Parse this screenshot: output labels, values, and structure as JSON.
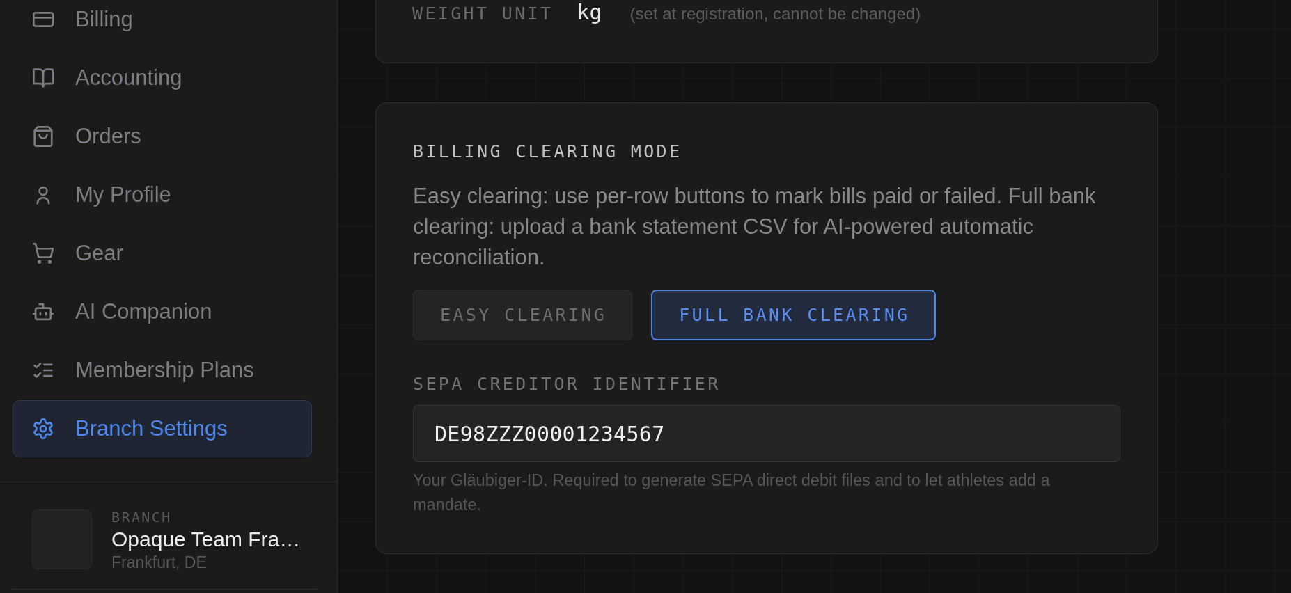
{
  "sidebar": {
    "nav_items": [
      {
        "label": "Billing",
        "selected": false
      },
      {
        "label": "Accounting",
        "selected": false
      },
      {
        "label": "Orders",
        "selected": false
      },
      {
        "label": "My Profile",
        "selected": false
      },
      {
        "label": "Gear",
        "selected": false
      },
      {
        "label": "AI Companion",
        "selected": false
      },
      {
        "label": "Membership Plans",
        "selected": false
      },
      {
        "label": "Branch Settings",
        "selected": true
      }
    ],
    "branch": {
      "label": "BRANCH",
      "name": "Opaque Team Fra…",
      "location": "Frankfurt, DE"
    }
  },
  "weight_unit": {
    "label": "WEIGHT UNIT",
    "value": "kg",
    "note": "(set at registration, cannot be changed)"
  },
  "billing_clearing": {
    "title": "BILLING CLEARING MODE",
    "description": "Easy clearing: use per-row buttons to mark bills paid or failed. Full bank clearing: upload a bank statement CSV for AI-powered automatic reconciliation.",
    "options": [
      {
        "label": "EASY CLEARING",
        "selected": false
      },
      {
        "label": "FULL BANK CLEARING",
        "selected": true
      }
    ],
    "sepa": {
      "label": "SEPA CREDITOR IDENTIFIER",
      "value": "DE98ZZZ00001234567",
      "hint": "Your Gläubiger-ID. Required to generate SEPA direct debit files and to let athletes add a mandate."
    }
  }
}
